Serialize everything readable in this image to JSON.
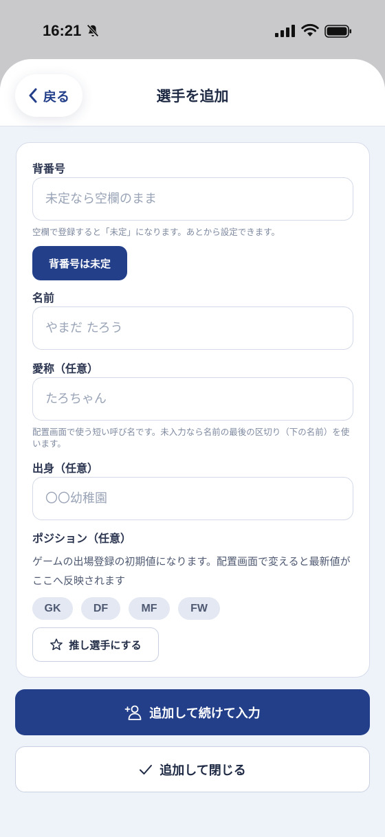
{
  "status_bar": {
    "time": "16:21",
    "icons": [
      "bell-off-icon",
      "signal-icon",
      "wifi-icon",
      "battery-icon"
    ]
  },
  "header": {
    "back_label": "戻る",
    "title": "選手を追加"
  },
  "form": {
    "number": {
      "label": "背番号",
      "placeholder": "未定なら空欄のまま",
      "value": "",
      "help": "空欄で登録すると「未定」になります。あとから設定できます。",
      "undecided_button": "背番号は未定"
    },
    "name": {
      "label": "名前",
      "placeholder": "やまだ たろう",
      "value": ""
    },
    "nickname": {
      "label": "愛称（任意）",
      "placeholder": "たろちゃん",
      "value": "",
      "help": "配置画面で使う短い呼び名です。未入力なら名前の最後の区切り（下の名前）を使います。"
    },
    "origin": {
      "label": "出身（任意）",
      "placeholder": "〇〇幼稚園",
      "value": ""
    },
    "position": {
      "label": "ポジション（任意）",
      "description": "ゲームの出場登録の初期値になります。配置画面で変えると最新値がここへ反映されます",
      "options": [
        "GK",
        "DF",
        "MF",
        "FW"
      ]
    },
    "favorite_button": "推し選手にする"
  },
  "actions": {
    "add_continue": "追加して続けて入力",
    "add_close": "追加して閉じる"
  },
  "colors": {
    "primary": "#233f8a",
    "sheet_background": "#eef2f9",
    "chip_background": "#e3e8f2"
  }
}
